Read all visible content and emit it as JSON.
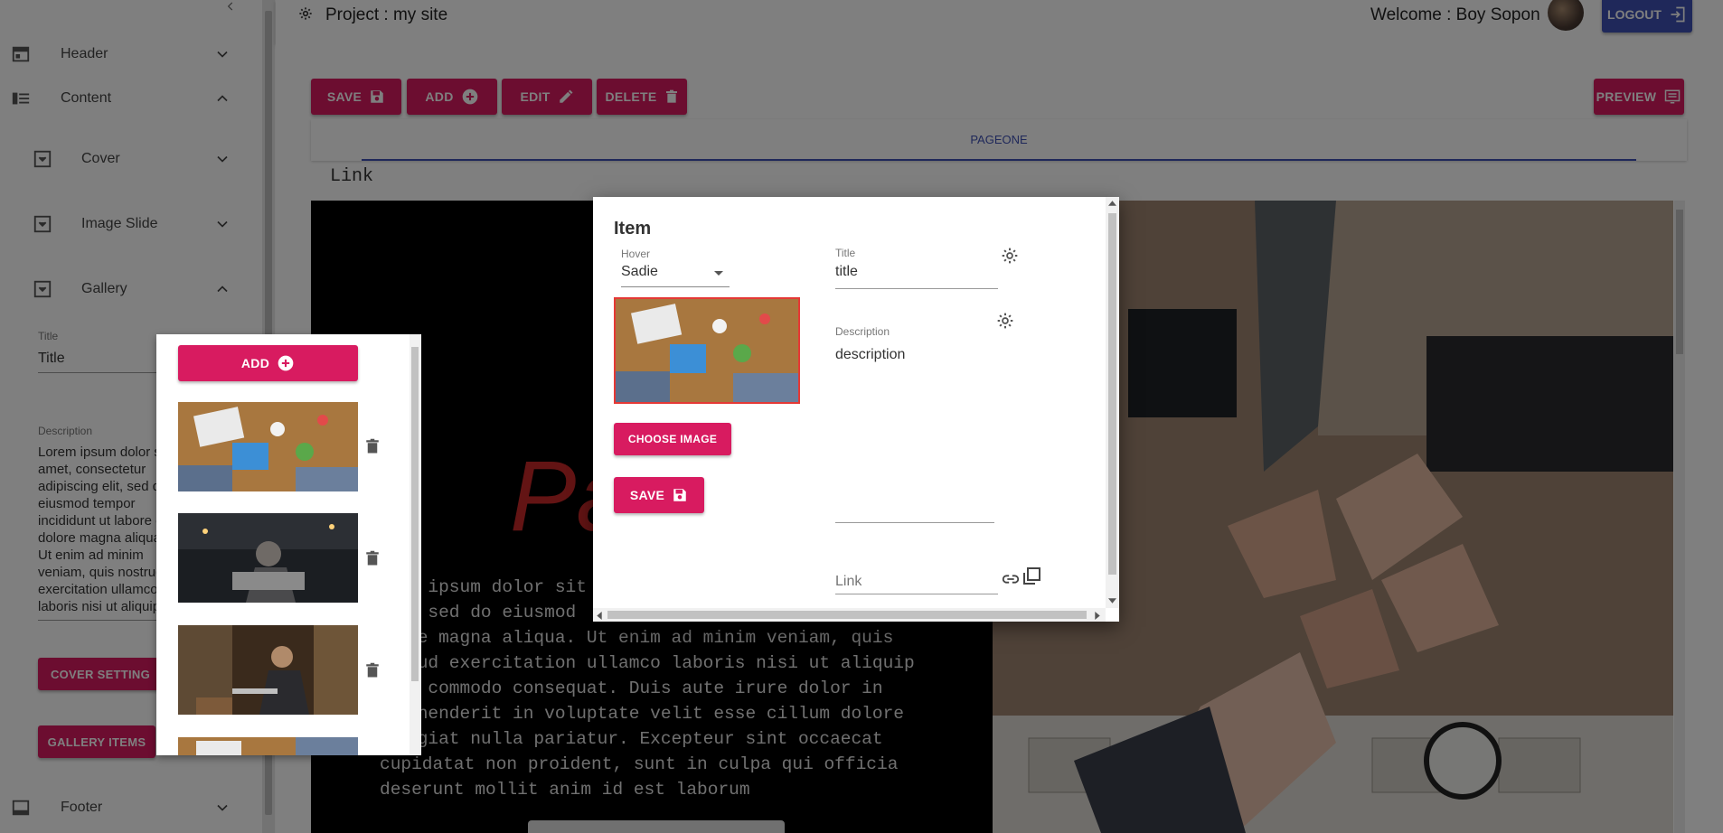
{
  "sidebar": {
    "sections": {
      "header": "Header",
      "content": "Content",
      "cover": "Cover",
      "image_slide": "Image Slide",
      "gallery": "Gallery",
      "footer": "Footer"
    },
    "gallery_form": {
      "title_label": "Title",
      "title_value": "Title",
      "description_label": "Description",
      "description_lines": [
        "Lorem ipsum dolor sit",
        "amet, consectetur",
        "adipiscing elit, sed do",
        "eiusmod tempor",
        "incididunt ut labore et",
        "dolore magna aliqua.",
        "Ut enim ad minim",
        "veniam, quis nostrud",
        "exercitation ullamco",
        "laboris nisi ut aliquip"
      ],
      "cover_setting_button": "COVER SETTING",
      "gallery_items_button": "GALLERY ITEMS"
    }
  },
  "topbar": {
    "project_label": "Project : my site",
    "welcome": "Welcome : Boy Sopon",
    "logout": "LOGOUT"
  },
  "toolbar": {
    "save": "SAVE",
    "add": "ADD",
    "edit": "EDIT",
    "delete": "DELETE",
    "preview": "PREVIEW"
  },
  "tabs": {
    "pageone": "PAGEONE"
  },
  "section_title": "Link",
  "preview": {
    "heading_fragment": "Pa",
    "body_lines": [
      "m ipsum dolor sit",
      ", sed do eiusmod",
      "re magna aliqua. Ut enim ad minim veniam, quis",
      "rud exercitation ullamco laboris nisi ut aliquip",
      "a commodo consequat. Duis aute irure dolor in",
      "ehenderit in voluptate velit esse cillum dolore",
      "ugiat nulla pariatur. Excepteur sint occaecat",
      "cupidatat non proident, sunt in culpa qui officia",
      "deserunt mollit anim id est laborum"
    ]
  },
  "gallery_panel": {
    "add_button": "ADD"
  },
  "dialog": {
    "title": "Item",
    "hover_label": "Hover",
    "hover_value": "Sadie",
    "choose_image": "CHOOSE IMAGE",
    "save": "SAVE",
    "title_label": "Title",
    "title_value": "title",
    "description_label": "Description",
    "description_value": "description",
    "link_placeholder": "Link"
  },
  "colors": {
    "accent": "#d81b60",
    "primary": "#3f51b5",
    "logout_bg": "#3f51b5"
  }
}
